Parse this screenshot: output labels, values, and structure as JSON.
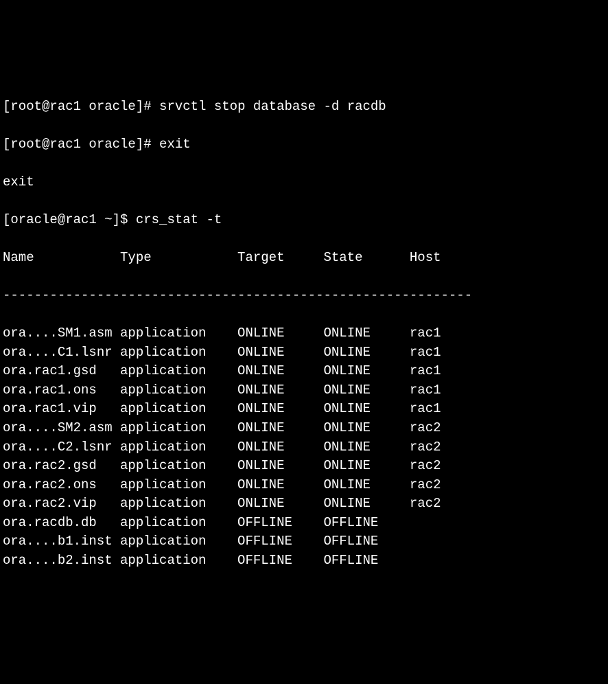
{
  "lines": {
    "prompt1": "[root@rac1 oracle]# ",
    "command1": "srvctl stop database -d racdb",
    "prompt2": "[root@rac1 oracle]# ",
    "command2": "exit",
    "exit_echo": "exit",
    "prompt3": "[oracle@rac1 ~]$ ",
    "command3": "crs_stat -t"
  },
  "table": {
    "headers": {
      "name": "Name",
      "type": "Type",
      "target": "Target",
      "state": "State",
      "host": "Host"
    },
    "divider": "------------------------------------------------------------",
    "rows": [
      {
        "name": "ora....SM1.asm",
        "type": "application",
        "target": "ONLINE",
        "state": "ONLINE",
        "host": "rac1"
      },
      {
        "name": "ora....C1.lsnr",
        "type": "application",
        "target": "ONLINE",
        "state": "ONLINE",
        "host": "rac1"
      },
      {
        "name": "ora.rac1.gsd",
        "type": "application",
        "target": "ONLINE",
        "state": "ONLINE",
        "host": "rac1"
      },
      {
        "name": "ora.rac1.ons",
        "type": "application",
        "target": "ONLINE",
        "state": "ONLINE",
        "host": "rac1"
      },
      {
        "name": "ora.rac1.vip",
        "type": "application",
        "target": "ONLINE",
        "state": "ONLINE",
        "host": "rac1"
      },
      {
        "name": "ora....SM2.asm",
        "type": "application",
        "target": "ONLINE",
        "state": "ONLINE",
        "host": "rac2"
      },
      {
        "name": "ora....C2.lsnr",
        "type": "application",
        "target": "ONLINE",
        "state": "ONLINE",
        "host": "rac2"
      },
      {
        "name": "ora.rac2.gsd",
        "type": "application",
        "target": "ONLINE",
        "state": "ONLINE",
        "host": "rac2"
      },
      {
        "name": "ora.rac2.ons",
        "type": "application",
        "target": "ONLINE",
        "state": "ONLINE",
        "host": "rac2"
      },
      {
        "name": "ora.rac2.vip",
        "type": "application",
        "target": "ONLINE",
        "state": "ONLINE",
        "host": "rac2"
      },
      {
        "name": "ora.racdb.db",
        "type": "application",
        "target": "OFFLINE",
        "state": "OFFLINE",
        "host": ""
      },
      {
        "name": "ora....b1.inst",
        "type": "application",
        "target": "OFFLINE",
        "state": "OFFLINE",
        "host": ""
      },
      {
        "name": "ora....b2.inst",
        "type": "application",
        "target": "OFFLINE",
        "state": "OFFLINE",
        "host": ""
      }
    ]
  }
}
